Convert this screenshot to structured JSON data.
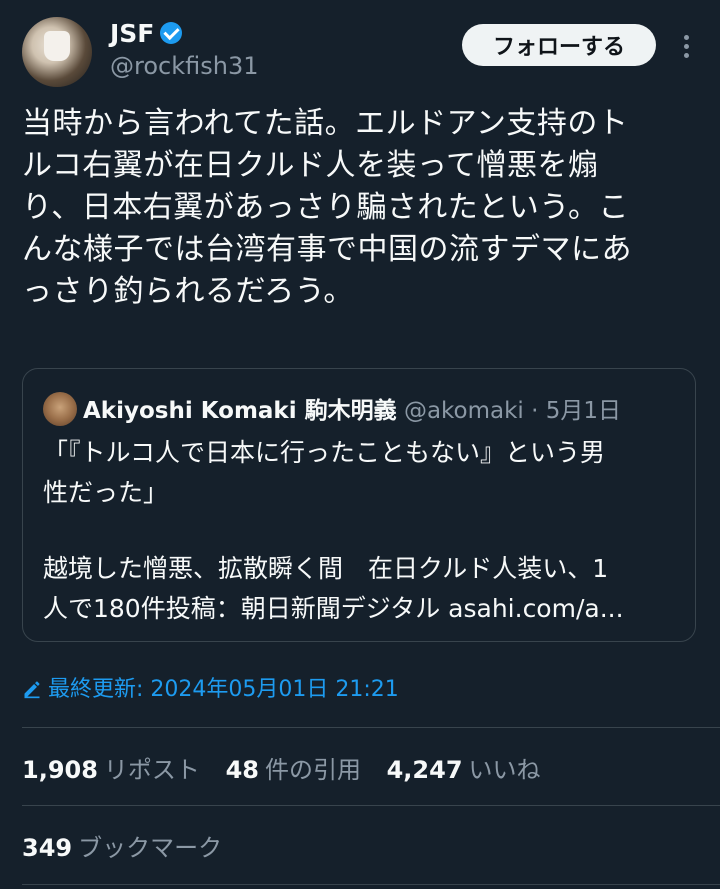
{
  "author": {
    "display_name": "JSF",
    "handle": "@rockfish31",
    "follow_label": "フォローする"
  },
  "tweet": {
    "lines": [
      "当時から言われてた話。エルドアン支持のト",
      "ルコ右翼が在日クルド人を装って憎悪を煽",
      "り、日本右翼があっさり騙されたという。こ",
      "んな様子では台湾有事で中国の流すデマにあ",
      "っさり釣られるだろう。"
    ]
  },
  "quote": {
    "name": "Akiyoshi Komaki 駒木明義",
    "handle": "@akomaki",
    "separator": "·",
    "date": "5月1日",
    "lines_a": [
      "「『トルコ人で日本に行ったこともない』という男",
      "性だった」"
    ],
    "lines_b": [
      "越境した憎悪、拡散瞬く間　在日クルド人装い、1",
      "人で180件投稿：朝日新聞デジタル asahi.com/a..."
    ]
  },
  "edited": {
    "text": "最終更新: 2024年05月01日 21:21"
  },
  "stats": {
    "reposts_count": "1,908",
    "reposts_label": "リポスト",
    "quotes_count": "48",
    "quotes_label": "件の引用",
    "likes_count": "4,247",
    "likes_label": "いいね",
    "bookmarks_count": "349",
    "bookmarks_label": "ブックマーク"
  },
  "icons": {
    "verified": "verified-badge-icon",
    "more": "more-options-icon",
    "edit": "pencil-icon"
  },
  "colors": {
    "background": "#15202b",
    "accent": "#1d9bf0",
    "muted": "#8b98a5",
    "border": "#38444d"
  }
}
